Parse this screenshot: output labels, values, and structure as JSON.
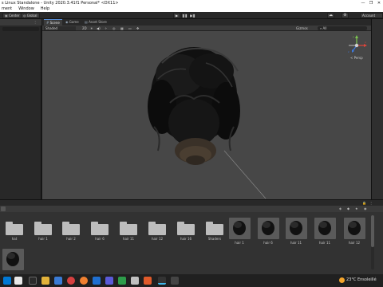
{
  "window": {
    "title": "s Linux Standalone - Unity 2020.3.41f1 Personal* <DX11>",
    "controls": [
      "—",
      "❐",
      "✕"
    ]
  },
  "menu": [
    "ment",
    "Window",
    "Help"
  ],
  "toolbar": {
    "left_buttons": [
      "Center",
      "Global"
    ],
    "play_controls": [
      "▶",
      "❚❚",
      "▶❚"
    ],
    "right_icons": [
      "☁",
      "⚙"
    ],
    "account_label": "Account"
  },
  "scene_tabs": [
    "Scene",
    "Game",
    "Asset Store"
  ],
  "scene_bar": {
    "shading_mode": "Shaded",
    "mode_2d": "2D",
    "gizmos": "Gizmos",
    "search_placeholder": "All"
  },
  "gizmo": {
    "axes": [
      "y",
      "x",
      "z"
    ],
    "projection_label": "< Persp"
  },
  "project_items": [
    {
      "type": "folder",
      "label": "hat"
    },
    {
      "type": "folder",
      "label": "hair 1"
    },
    {
      "type": "folder",
      "label": "hair 2"
    },
    {
      "type": "folder",
      "label": "hair 6"
    },
    {
      "type": "folder",
      "label": "hair 11"
    },
    {
      "type": "folder",
      "label": "hair 12"
    },
    {
      "type": "folder",
      "label": "hair 16"
    },
    {
      "type": "folder",
      "label": "Shaders"
    },
    {
      "type": "hair",
      "label": "hair 1"
    },
    {
      "type": "hair",
      "label": "hair 6"
    },
    {
      "type": "hair",
      "label": "hair 11"
    },
    {
      "type": "hair",
      "label": "hair 11"
    },
    {
      "type": "hair",
      "label": "hair 12"
    },
    {
      "type": "hair",
      "label": ""
    }
  ],
  "taskbar": {
    "weather": "23°C Ensoleillé",
    "colors": {
      "start": "#0078d4",
      "accent": "#3a7bd5",
      "status_dot": "#3fb6e8",
      "weather_icon": "#f4a52c"
    }
  }
}
